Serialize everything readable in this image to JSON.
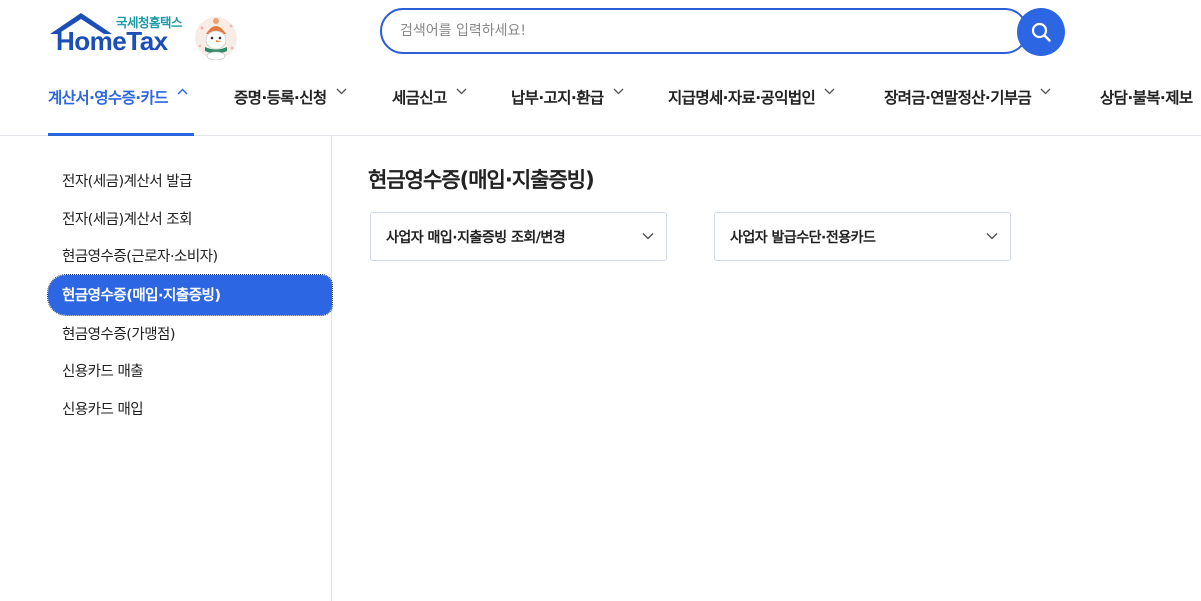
{
  "logo": {
    "sub_text": "국세청홈택스",
    "brand_text": "HomeTax"
  },
  "search": {
    "placeholder": "검색어를 입력하세요!"
  },
  "gnb": [
    {
      "label": "계산서·영수증·카드",
      "active": true
    },
    {
      "label": "증명·등록·신청",
      "active": false
    },
    {
      "label": "세금신고",
      "active": false
    },
    {
      "label": "납부·고지·환급",
      "active": false
    },
    {
      "label": "지급명세·자료·공익법인",
      "active": false
    },
    {
      "label": "장려금·연말정산·기부금",
      "active": false
    },
    {
      "label": "상담·불복·제보",
      "active": false
    }
  ],
  "sidebar": {
    "items": [
      {
        "label": "전자(세금)계산서 발급"
      },
      {
        "label": "전자(세금)계산서 조회"
      },
      {
        "label": "현금영수증(근로자·소비자)"
      },
      {
        "label": "현금영수증(매입·지출증빙)"
      },
      {
        "label": "현금영수증(가맹점)"
      },
      {
        "label": "신용카드 매출"
      },
      {
        "label": "신용카드 매입"
      }
    ],
    "active_index": 3
  },
  "main": {
    "title": "현금영수증(매입·지출증빙)",
    "dropdowns": [
      {
        "label": "사업자 매입·지출증빙 조회/변경"
      },
      {
        "label": "사업자 발급수단·전용카드"
      }
    ]
  },
  "colors": {
    "accent": "#2d66e3",
    "brand": "#1c4eb8",
    "brand_sub": "#1d9aa6",
    "border": "#e3e6ea"
  }
}
